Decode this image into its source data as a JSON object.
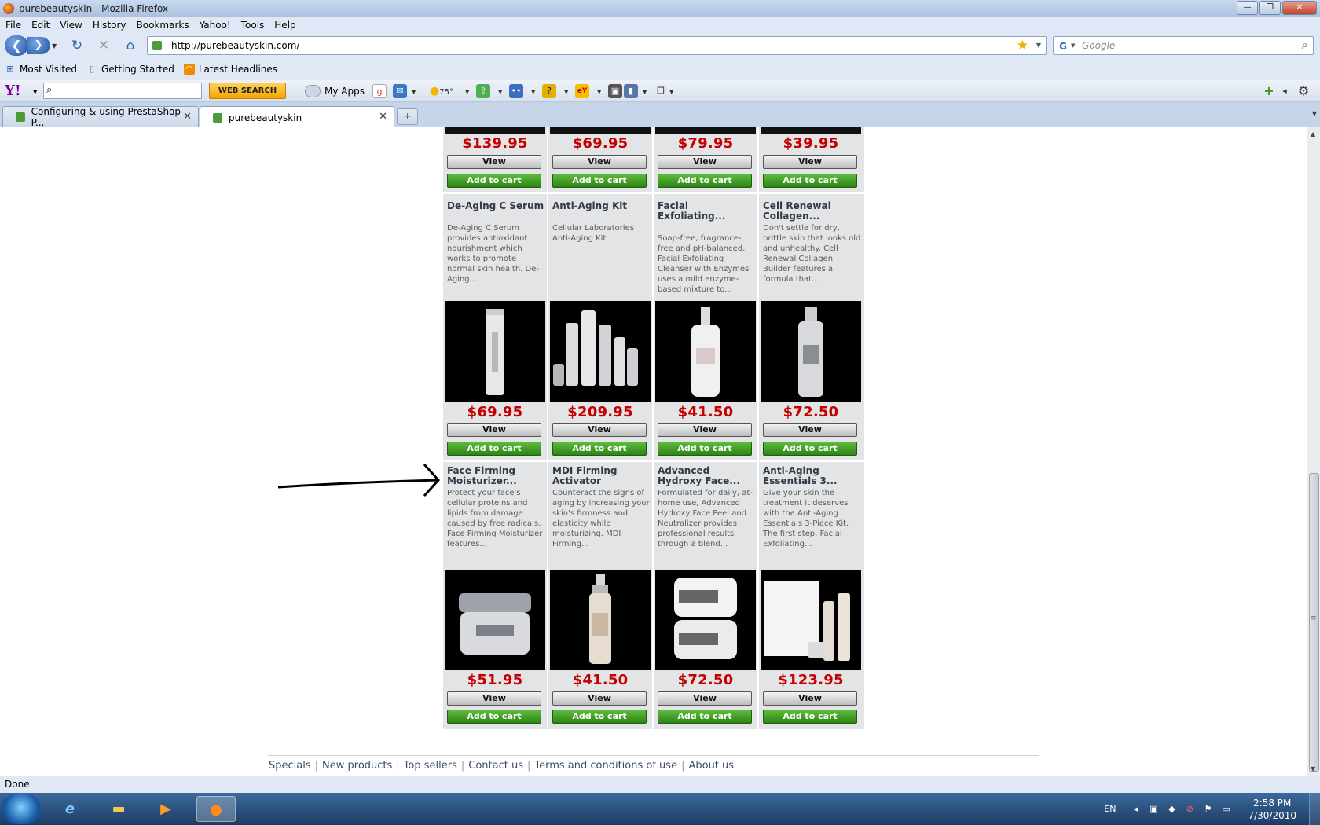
{
  "window": {
    "title": "purebeautyskin - Mozilla Firefox"
  },
  "menu": [
    "File",
    "Edit",
    "View",
    "History",
    "Bookmarks",
    "Yahoo!",
    "Tools",
    "Help"
  ],
  "nav": {
    "url": "http://purebeautyskin.com/",
    "search_placeholder": "Google"
  },
  "bookmarks": [
    "Most Visited",
    "Getting Started",
    "Latest Headlines"
  ],
  "yahoo": {
    "web_search": "WEB SEARCH",
    "my_apps": "My Apps",
    "weather": "75°"
  },
  "tabs": [
    {
      "label": "Configuring & using PrestaShop - P...",
      "active": false
    },
    {
      "label": "purebeautyskin",
      "active": true
    }
  ],
  "top_row_prices": [
    "$139.95",
    "$69.95",
    "$79.95",
    "$39.95"
  ],
  "products": [
    {
      "name": "De-Aging C Serum",
      "desc": "De-Aging C Serum provides antioxidant nourishment which works to promote normal skin health. De-Aging...",
      "price": "$69.95"
    },
    {
      "name": "Anti-Aging Kit",
      "desc": "Cellular Laboratories Anti-Aging Kit",
      "price": "$209.95"
    },
    {
      "name": "Facial Exfoliating...",
      "desc": "Soap-free, fragrance-free and pH-balanced, Facial Exfoliating Cleanser with Enzymes uses a mild enzyme-based mixture to...",
      "price": "$41.50"
    },
    {
      "name": "Cell Renewal Collagen...",
      "desc": "Don't settle for dry, brittle skin that looks old and unhealthy. Cell Renewal Collagen Builder features a formula that...",
      "price": "$72.50"
    },
    {
      "name": "Face Firming Moisturizer...",
      "desc": "Protect your face's cellular proteins and lipids from damage caused by free radicals. Face Firming Moisturizer features...",
      "price": "$51.95"
    },
    {
      "name": "MDI Firming Activator",
      "desc": "Counteract the signs of aging by increasing your skin's firmness and elasticity while moisturizing. MDI Firming...",
      "price": "$41.50"
    },
    {
      "name": "Advanced Hydroxy Face...",
      "desc": "Formulated for daily, at-home use, Advanced Hydroxy Face Peel and Neutralizer provides professional results through a blend...",
      "price": "$72.50"
    },
    {
      "name": "Anti-Aging Essentials 3...",
      "desc": "Give your skin the treatment it deserves with the Anti-Aging Essentials 3-Piece Kit. The first step, Facial Exfoliating...",
      "price": "$123.95"
    }
  ],
  "buttons": {
    "view": "View",
    "cart": "Add to cart"
  },
  "footer": [
    "Specials",
    "New products",
    "Top sellers",
    "Contact us",
    "Terms and conditions of use",
    "About us"
  ],
  "status": "Done",
  "tray": {
    "lang": "EN",
    "time": "2:58 PM",
    "date": "7/30/2010"
  },
  "colors": {
    "price": "#c40000",
    "cart_button": "#3a9a22",
    "grid_bg": "#e3e4e6"
  }
}
